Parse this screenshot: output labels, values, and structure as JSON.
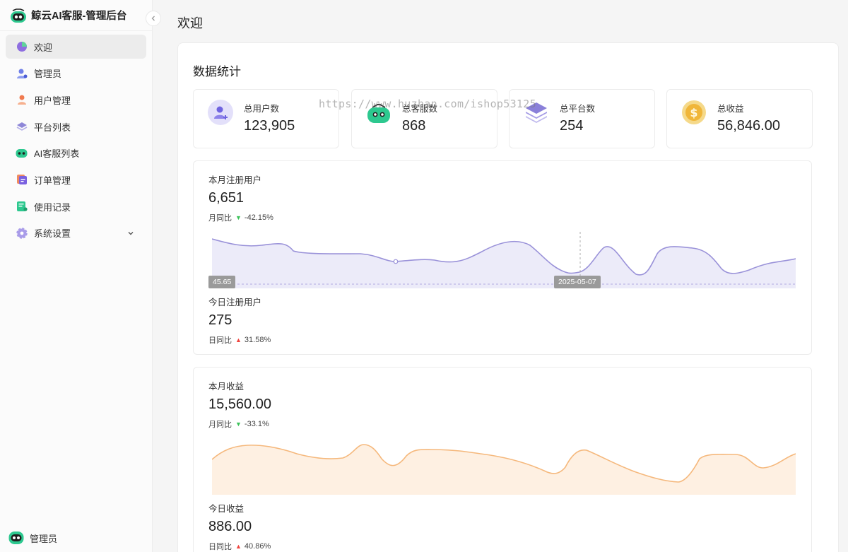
{
  "app": {
    "title": "鲸云AI客服-管理后台"
  },
  "sidebar": {
    "items": [
      {
        "label": "欢迎",
        "icon": "pie-chart-icon",
        "active": true
      },
      {
        "label": "管理员",
        "icon": "admin-user-icon"
      },
      {
        "label": "用户管理",
        "icon": "user-manage-icon"
      },
      {
        "label": "平台列表",
        "icon": "layers-icon"
      },
      {
        "label": "AI客服列表",
        "icon": "robot-icon"
      },
      {
        "label": "订单管理",
        "icon": "order-icon"
      },
      {
        "label": "使用记录",
        "icon": "record-icon"
      },
      {
        "label": "系统设置",
        "icon": "gear-icon",
        "expandable": true
      }
    ],
    "footer_user": "管理员"
  },
  "page": {
    "title": "欢迎"
  },
  "stats": {
    "title": "数据统计",
    "cards": [
      {
        "label": "总用户数",
        "value": "123,905",
        "icon": "add-user-icon"
      },
      {
        "label": "总客服数",
        "value": "868",
        "icon": "robot-icon"
      },
      {
        "label": "总平台数",
        "value": "254",
        "icon": "layers-icon"
      },
      {
        "label": "总收益",
        "value": "56,846.00",
        "icon": "coin-icon"
      }
    ]
  },
  "users_panel": {
    "month_label": "本月注册用户",
    "month_value": "6,651",
    "month_compare_label": "月同比",
    "month_compare_value": "-42.15%",
    "today_label": "今日注册用户",
    "today_value": "275",
    "today_compare_label": "日同比",
    "today_compare_value": "31.58%",
    "tooltip_value": "45.65",
    "tooltip_date": "2025-05-07",
    "color": "#9a92d9"
  },
  "revenue_panel": {
    "month_label": "本月收益",
    "month_value": "15,560.00",
    "month_compare_label": "月同比",
    "month_compare_value": "-33.1%",
    "today_label": "今日收益",
    "today_value": "886.00",
    "today_compare_label": "日同比",
    "today_compare_value": "40.86%",
    "color": "#f5b87c"
  },
  "watermark": "https://www.huzhan.com/ishop53125"
}
